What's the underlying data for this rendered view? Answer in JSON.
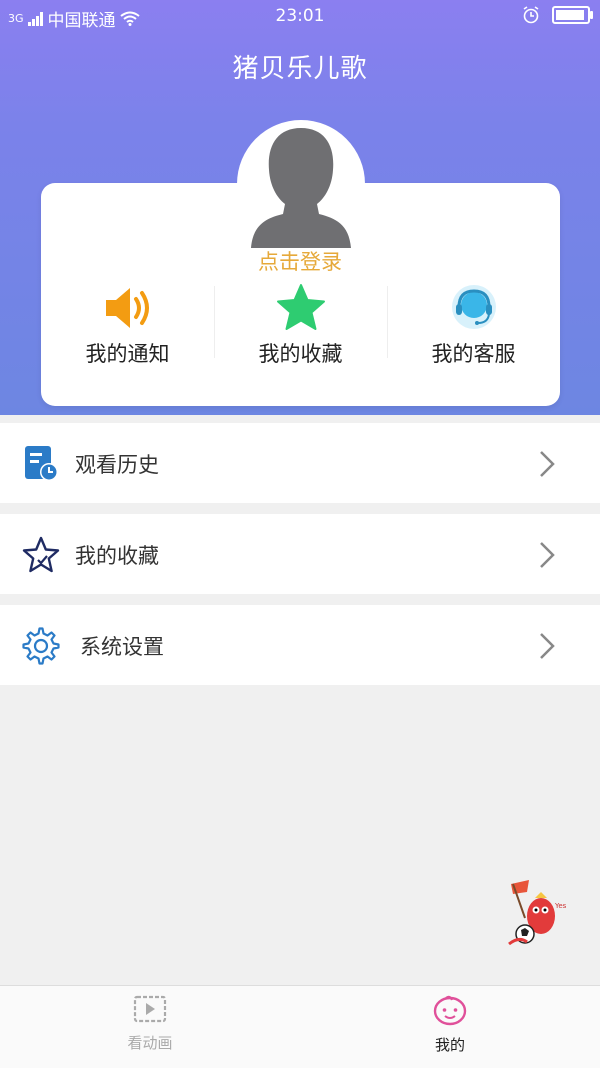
{
  "status_bar": {
    "network": "3G",
    "carrier": "中国联通",
    "time": "23:01"
  },
  "app": {
    "title": "猪贝乐儿歌"
  },
  "profile": {
    "login_text": "点击登录"
  },
  "quick_actions": [
    {
      "label": "我的通知",
      "icon": "speaker-icon",
      "color": "#f39c12"
    },
    {
      "label": "我的收藏",
      "icon": "star-icon",
      "color": "#2ecc71"
    },
    {
      "label": "我的客服",
      "icon": "headset-icon",
      "color": "#3ab6e8"
    }
  ],
  "menu": [
    {
      "label": "观看历史",
      "icon": "history-icon"
    },
    {
      "label": "我的收藏",
      "icon": "star-outline-icon"
    },
    {
      "label": "系统设置",
      "icon": "gear-icon"
    }
  ],
  "tabs": [
    {
      "label": "看动画",
      "icon": "video-icon",
      "active": false
    },
    {
      "label": "我的",
      "icon": "baby-face-icon",
      "active": true
    }
  ],
  "colors": {
    "header_gradient_top": "#8b7ff0",
    "header_gradient_bottom": "#6d86e2",
    "login_text": "#e6a93a",
    "tab_active": "#222222",
    "tab_inactive": "#aaaaaa",
    "menu_icon": "#2b7bc7"
  }
}
